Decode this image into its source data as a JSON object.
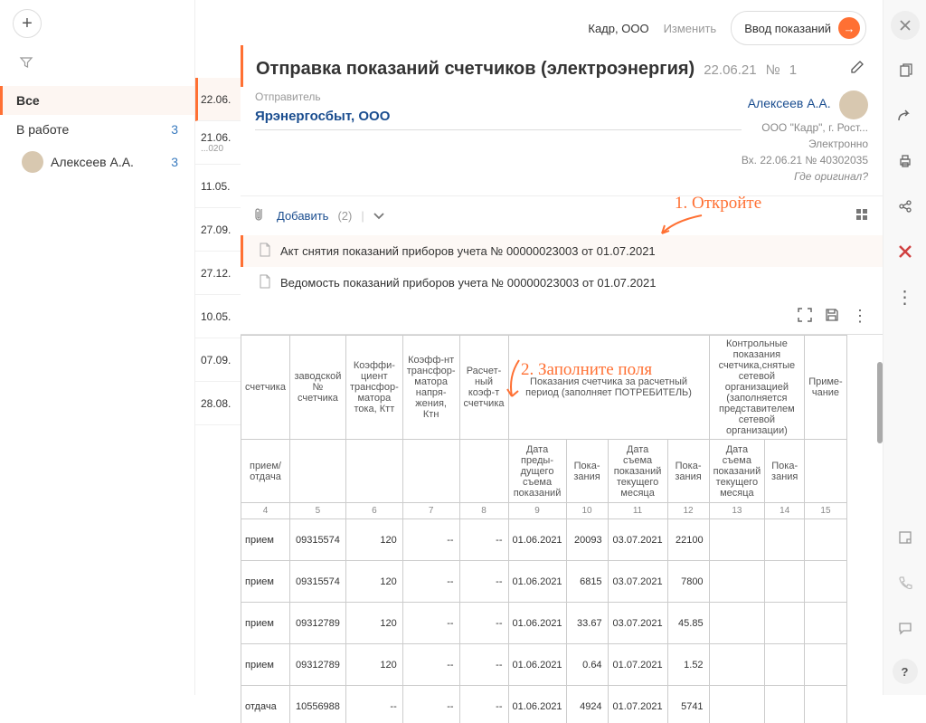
{
  "sidebar": {
    "filters": [
      {
        "label": "Все",
        "active": true
      },
      {
        "label": "В работе",
        "count": 3
      },
      {
        "label": "Алексеев А.А.",
        "count": 3,
        "avatar": true
      }
    ]
  },
  "timeline": [
    {
      "d": "22.06.",
      "sel": true
    },
    {
      "d": "21.06.",
      "sub": "...020"
    },
    {
      "d": "11.05."
    },
    {
      "d": "27.09."
    },
    {
      "d": "27.12."
    },
    {
      "d": "10.05."
    },
    {
      "d": "07.09."
    },
    {
      "d": "28.08."
    }
  ],
  "header": {
    "org": "Кадр, ООО",
    "change": "Изменить",
    "input_btn": "Ввод показаний"
  },
  "title": {
    "text": "Отправка показаний счетчиков (электроэнергия)",
    "date": "22.06.21",
    "num_label": "№",
    "num": "1"
  },
  "sender": {
    "label": "Отправитель",
    "name": "Ярэнергосбыт, ООО"
  },
  "author": {
    "name": "Алексеев А.А.",
    "org": "ООО \"Кадр\", г. Рост...",
    "method": "Электронно",
    "inbox": "Вх. 22.06.21 № 40302035",
    "original": "Где оригинал?"
  },
  "attach": {
    "add": "Добавить",
    "count": "(2)",
    "docs": [
      "Акт снятия показаний приборов учета № 00000023003 от 01.07.2021",
      "Ведомость показаний приборов учета № 00000023003 от 01.07.2021"
    ]
  },
  "annotations": {
    "a1": "1. Откройте",
    "a2": "2. Заполните поля"
  },
  "table": {
    "headers": {
      "h1": "счетчика",
      "h2": "заводской № счетчика",
      "h3": "Коэффи-циент трансфор-матора тока, Ктт",
      "h4": "Коэфф-нт трансфор-матора напря-жения, Ктн",
      "h5": "Расчет-ный коэф-т счетчика",
      "h6": "Показания счетчика за расчетный период (заполняет ПОТРЕБИТЕЛЬ)",
      "h7": "Контрольные показания счетчика,снятые сетевой организацией (заполняется представителем сетевой организации)",
      "h8": "Приме-чание",
      "sub1": "прием/отдача",
      "s6a": "Дата преды-дущего съема показаний",
      "s6b": "Пока-зания",
      "s6c": "Дата съема показаний текущего месяца",
      "s6d": "Пока-зания",
      "s7a": "Дата съема показаний текущего месяца",
      "s7b": "Пока-зания"
    },
    "cols": [
      "4",
      "5",
      "6",
      "7",
      "8",
      "9",
      "10",
      "11",
      "12",
      "13",
      "14",
      "15"
    ],
    "rows": [
      {
        "t": "прием",
        "sn": "09315574",
        "ktt": "120",
        "ktn": "--",
        "kr": "--",
        "d1": "01.06.2021",
        "v1": "20093",
        "d2": "03.07.2021",
        "v2": "22100"
      },
      {
        "t": "прием",
        "sn": "09315574",
        "ktt": "120",
        "ktn": "--",
        "kr": "--",
        "d1": "01.06.2021",
        "v1": "6815",
        "d2": "03.07.2021",
        "v2": "7800"
      },
      {
        "t": "прием",
        "sn": "09312789",
        "ktt": "120",
        "ktn": "--",
        "kr": "--",
        "d1": "01.06.2021",
        "v1": "33.67",
        "d2": "03.07.2021",
        "v2": "45.85"
      },
      {
        "t": "прием",
        "sn": "09312789",
        "ktt": "120",
        "ktn": "--",
        "kr": "--",
        "d1": "01.06.2021",
        "v1": "0.64",
        "d2": "01.07.2021",
        "v2": "1.52"
      },
      {
        "t": "отдача",
        "sn": "10556988",
        "ktt": "--",
        "ktn": "--",
        "kr": "--",
        "d1": "01.06.2021",
        "v1": "4924",
        "d2": "01.07.2021",
        "v2": "5741"
      }
    ]
  }
}
